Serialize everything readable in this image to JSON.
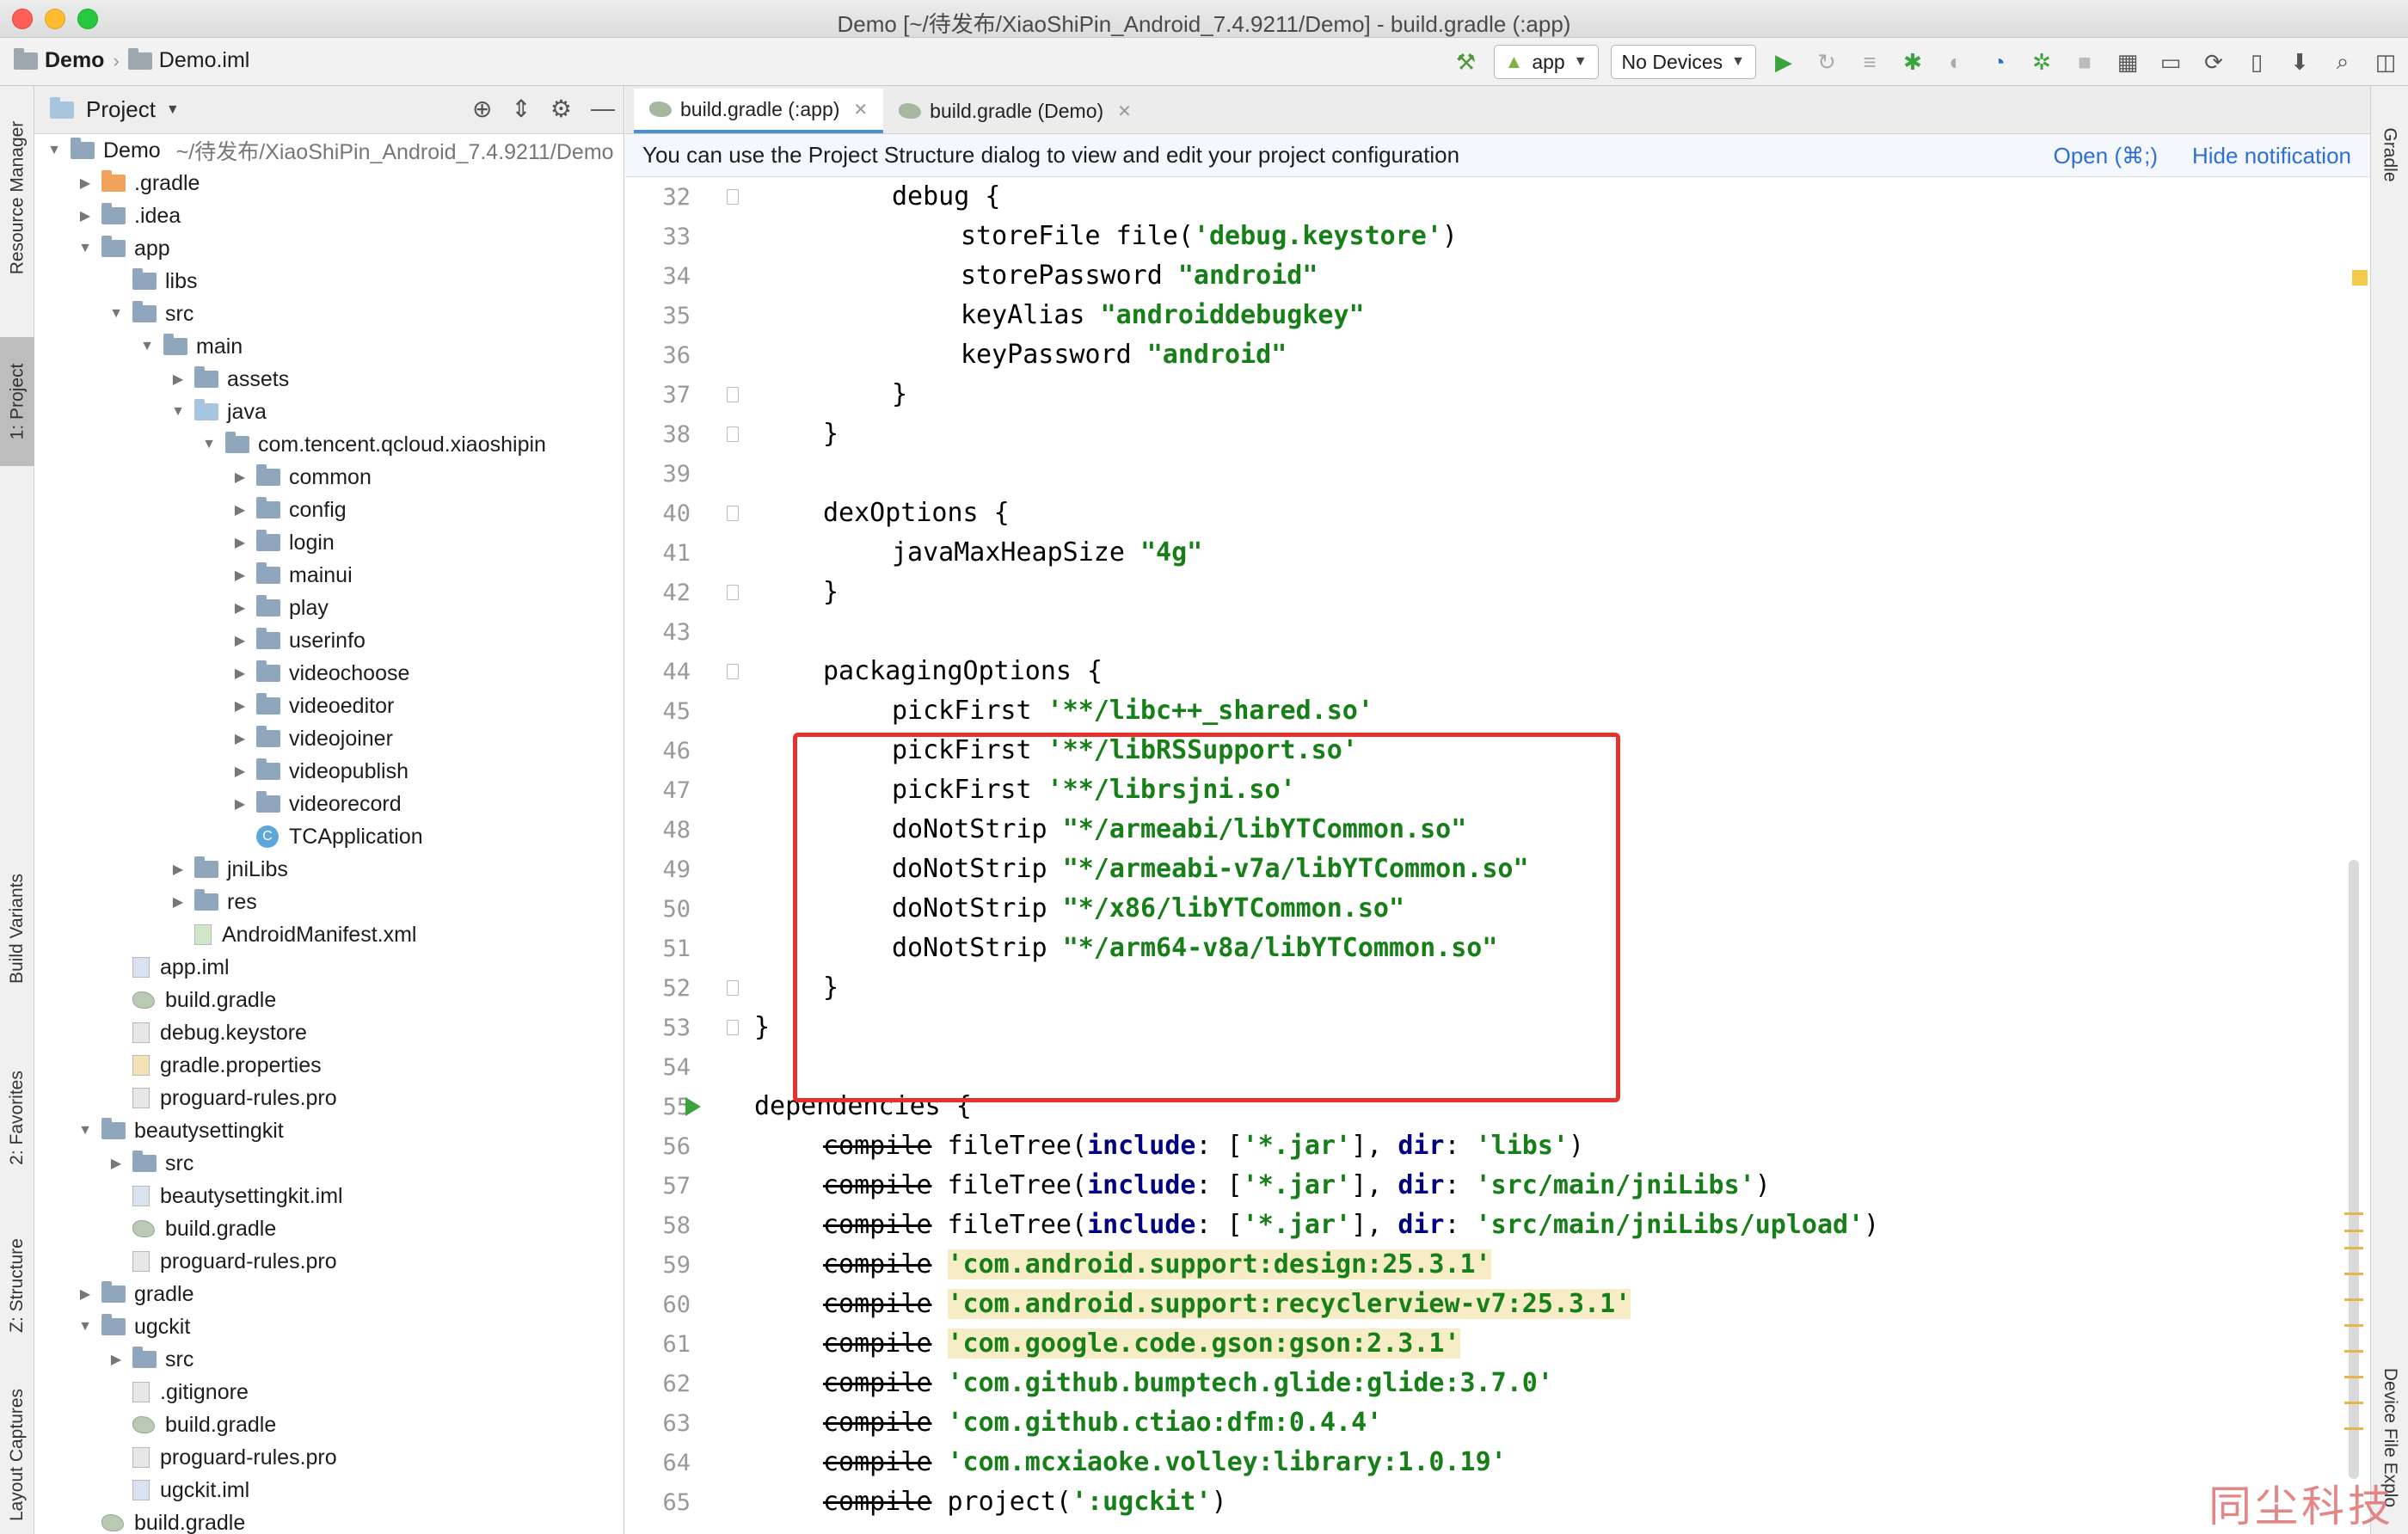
{
  "window": {
    "title": "Demo [~/待发布/XiaoShiPin_Android_7.4.9211/Demo] - build.gradle (:app)"
  },
  "nav": {
    "crumb_project": "Demo",
    "crumb_file": "Demo.iml",
    "run_config": "app",
    "device": "No Devices"
  },
  "left_tools": {
    "resource_manager": "Resource Manager",
    "project": "1: Project",
    "build_variants": "Build Variants",
    "favorites": "2: Favorites",
    "structure": "Z: Structure",
    "layout_captures": "Layout Captures"
  },
  "right_tools": {
    "gradle": "Gradle",
    "device_file": "Device File Explo"
  },
  "project_panel": {
    "title": "Project",
    "tree": [
      {
        "label": "Demo",
        "path": "~/待发布/XiaoShiPin_Android_7.4.9211/Demo",
        "depth": 0,
        "arrow": "down",
        "icon": "folder"
      },
      {
        "label": ".gradle",
        "depth": 1,
        "arrow": "right",
        "icon": "folder-orange"
      },
      {
        "label": ".idea",
        "depth": 1,
        "arrow": "right",
        "icon": "folder"
      },
      {
        "label": "app",
        "depth": 1,
        "arrow": "down",
        "icon": "folder"
      },
      {
        "label": "libs",
        "depth": 2,
        "arrow": "",
        "icon": "folder"
      },
      {
        "label": "src",
        "depth": 2,
        "arrow": "down",
        "icon": "folder"
      },
      {
        "label": "main",
        "depth": 3,
        "arrow": "down",
        "icon": "folder"
      },
      {
        "label": "assets",
        "depth": 4,
        "arrow": "right",
        "icon": "folder"
      },
      {
        "label": "java",
        "depth": 4,
        "arrow": "down",
        "icon": "folder-light"
      },
      {
        "label": "com.tencent.qcloud.xiaoshipin",
        "depth": 5,
        "arrow": "down",
        "icon": "folder"
      },
      {
        "label": "common",
        "depth": 6,
        "arrow": "right",
        "icon": "folder"
      },
      {
        "label": "config",
        "depth": 6,
        "arrow": "right",
        "icon": "folder"
      },
      {
        "label": "login",
        "depth": 6,
        "arrow": "right",
        "icon": "folder"
      },
      {
        "label": "mainui",
        "depth": 6,
        "arrow": "right",
        "icon": "folder"
      },
      {
        "label": "play",
        "depth": 6,
        "arrow": "right",
        "icon": "folder"
      },
      {
        "label": "userinfo",
        "depth": 6,
        "arrow": "right",
        "icon": "folder"
      },
      {
        "label": "videochoose",
        "depth": 6,
        "arrow": "right",
        "icon": "folder"
      },
      {
        "label": "videoeditor",
        "depth": 6,
        "arrow": "right",
        "icon": "folder"
      },
      {
        "label": "videojoiner",
        "depth": 6,
        "arrow": "right",
        "icon": "folder"
      },
      {
        "label": "videopublish",
        "depth": 6,
        "arrow": "right",
        "icon": "folder"
      },
      {
        "label": "videorecord",
        "depth": 6,
        "arrow": "right",
        "icon": "folder"
      },
      {
        "label": "TCApplication",
        "depth": 6,
        "arrow": "",
        "icon": "class"
      },
      {
        "label": "jniLibs",
        "depth": 4,
        "arrow": "right",
        "icon": "folder"
      },
      {
        "label": "res",
        "depth": 4,
        "arrow": "right",
        "icon": "folder"
      },
      {
        "label": "AndroidManifest.xml",
        "depth": 4,
        "arrow": "",
        "icon": "manifest"
      },
      {
        "label": "app.iml",
        "depth": 2,
        "arrow": "",
        "icon": "iml"
      },
      {
        "label": "build.gradle",
        "depth": 2,
        "arrow": "",
        "icon": "gradle"
      },
      {
        "label": "debug.keystore",
        "depth": 2,
        "arrow": "",
        "icon": "file"
      },
      {
        "label": "gradle.properties",
        "depth": 2,
        "arrow": "",
        "icon": "properties"
      },
      {
        "label": "proguard-rules.pro",
        "depth": 2,
        "arrow": "",
        "icon": "file"
      },
      {
        "label": "beautysettingkit",
        "depth": 1,
        "arrow": "down",
        "icon": "folder"
      },
      {
        "label": "src",
        "depth": 2,
        "arrow": "right",
        "icon": "folder"
      },
      {
        "label": "beautysettingkit.iml",
        "depth": 2,
        "arrow": "",
        "icon": "iml"
      },
      {
        "label": "build.gradle",
        "depth": 2,
        "arrow": "",
        "icon": "gradle"
      },
      {
        "label": "proguard-rules.pro",
        "depth": 2,
        "arrow": "",
        "icon": "file"
      },
      {
        "label": "gradle",
        "depth": 1,
        "arrow": "right",
        "icon": "folder"
      },
      {
        "label": "ugckit",
        "depth": 1,
        "arrow": "down",
        "icon": "folder"
      },
      {
        "label": "src",
        "depth": 2,
        "arrow": "right",
        "icon": "folder"
      },
      {
        "label": ".gitignore",
        "depth": 2,
        "arrow": "",
        "icon": "file"
      },
      {
        "label": "build.gradle",
        "depth": 2,
        "arrow": "",
        "icon": "gradle"
      },
      {
        "label": "proguard-rules.pro",
        "depth": 2,
        "arrow": "",
        "icon": "file"
      },
      {
        "label": "ugckit.iml",
        "depth": 2,
        "arrow": "",
        "icon": "iml"
      },
      {
        "label": "build.gradle",
        "depth": 1,
        "arrow": "",
        "icon": "gradle"
      }
    ]
  },
  "editor": {
    "tabs": [
      {
        "label": "build.gradle (:app)",
        "active": true
      },
      {
        "label": "build.gradle (Demo)",
        "active": false
      }
    ],
    "notification": {
      "text": "You can use the Project Structure dialog to view and edit your project configuration",
      "open_link": "Open (⌘;)",
      "hide_link": "Hide notification"
    },
    "lines": [
      {
        "n": "32",
        "indent": 2,
        "parts": [
          [
            "t",
            "debug {"
          ]
        ]
      },
      {
        "n": "33",
        "indent": 3,
        "parts": [
          [
            "t",
            "storeFile file("
          ],
          [
            "s",
            "'debug.keystore'"
          ],
          [
            "t",
            ")"
          ]
        ]
      },
      {
        "n": "34",
        "indent": 3,
        "parts": [
          [
            "t",
            "storePassword "
          ],
          [
            "s",
            "\"android\""
          ]
        ]
      },
      {
        "n": "35",
        "indent": 3,
        "parts": [
          [
            "t",
            "keyAlias "
          ],
          [
            "s",
            "\"androiddebugkey\""
          ]
        ]
      },
      {
        "n": "36",
        "indent": 3,
        "parts": [
          [
            "t",
            "keyPassword "
          ],
          [
            "s",
            "\"android\""
          ]
        ]
      },
      {
        "n": "37",
        "indent": 2,
        "parts": [
          [
            "t",
            "}"
          ]
        ]
      },
      {
        "n": "38",
        "indent": 1,
        "parts": [
          [
            "t",
            "}"
          ]
        ]
      },
      {
        "n": "39",
        "indent": 0,
        "parts": []
      },
      {
        "n": "40",
        "indent": 1,
        "parts": [
          [
            "t",
            "dexOptions {"
          ]
        ]
      },
      {
        "n": "41",
        "indent": 2,
        "parts": [
          [
            "t",
            "javaMaxHeapSize "
          ],
          [
            "s",
            "\"4g\""
          ]
        ]
      },
      {
        "n": "42",
        "indent": 1,
        "parts": [
          [
            "t",
            "}"
          ]
        ]
      },
      {
        "n": "43",
        "indent": 0,
        "parts": []
      },
      {
        "n": "44",
        "indent": 1,
        "parts": [
          [
            "t",
            "packagingOptions {"
          ]
        ]
      },
      {
        "n": "45",
        "indent": 2,
        "parts": [
          [
            "t",
            "pickFirst "
          ],
          [
            "s",
            "'**/libc++_shared.so'"
          ]
        ]
      },
      {
        "n": "46",
        "indent": 2,
        "parts": [
          [
            "t",
            "pickFirst "
          ],
          [
            "s",
            "'**/libRSSupport.so'"
          ]
        ]
      },
      {
        "n": "47",
        "indent": 2,
        "parts": [
          [
            "t",
            "pickFirst "
          ],
          [
            "s",
            "'**/librsjni.so'"
          ]
        ]
      },
      {
        "n": "48",
        "indent": 2,
        "parts": [
          [
            "t",
            "doNotStrip "
          ],
          [
            "s",
            "\"*/armeabi/libYTCommon.so\""
          ]
        ]
      },
      {
        "n": "49",
        "indent": 2,
        "parts": [
          [
            "t",
            "doNotStrip "
          ],
          [
            "s",
            "\"*/armeabi-v7a/libYTCommon.so\""
          ]
        ]
      },
      {
        "n": "50",
        "indent": 2,
        "parts": [
          [
            "t",
            "doNotStrip "
          ],
          [
            "s",
            "\"*/x86/libYTCommon.so\""
          ]
        ]
      },
      {
        "n": "51",
        "indent": 2,
        "parts": [
          [
            "t",
            "doNotStrip "
          ],
          [
            "s",
            "\"*/arm64-v8a/libYTCommon.so\""
          ]
        ]
      },
      {
        "n": "52",
        "indent": 1,
        "parts": [
          [
            "t",
            "}"
          ]
        ]
      },
      {
        "n": "53",
        "indent": 0,
        "parts": [
          [
            "t",
            "}"
          ]
        ]
      },
      {
        "n": "54",
        "indent": 0,
        "parts": []
      },
      {
        "n": "55",
        "indent": 0,
        "parts": [
          [
            "t",
            "dependencies {"
          ]
        ]
      },
      {
        "n": "56",
        "indent": 1,
        "parts": [
          [
            "x",
            "compile"
          ],
          [
            "t",
            " fileTree("
          ],
          [
            "k",
            "include"
          ],
          [
            "t",
            ": ["
          ],
          [
            "s",
            "'*.jar'"
          ],
          [
            "t",
            "], "
          ],
          [
            "k",
            "dir"
          ],
          [
            "t",
            ": "
          ],
          [
            "s",
            "'libs'"
          ],
          [
            "t",
            ")"
          ]
        ]
      },
      {
        "n": "57",
        "indent": 1,
        "parts": [
          [
            "x",
            "compile"
          ],
          [
            "t",
            " fileTree("
          ],
          [
            "k",
            "include"
          ],
          [
            "t",
            ": ["
          ],
          [
            "s",
            "'*.jar'"
          ],
          [
            "t",
            "], "
          ],
          [
            "k",
            "dir"
          ],
          [
            "t",
            ": "
          ],
          [
            "s",
            "'src/main/jniLibs'"
          ],
          [
            "t",
            ")"
          ]
        ]
      },
      {
        "n": "58",
        "indent": 1,
        "parts": [
          [
            "x",
            "compile"
          ],
          [
            "t",
            " fileTree("
          ],
          [
            "k",
            "include"
          ],
          [
            "t",
            ": ["
          ],
          [
            "s",
            "'*.jar'"
          ],
          [
            "t",
            "], "
          ],
          [
            "k",
            "dir"
          ],
          [
            "t",
            ": "
          ],
          [
            "s",
            "'src/main/jniLibs/upload'"
          ],
          [
            "t",
            ")"
          ]
        ]
      },
      {
        "n": "59",
        "indent": 1,
        "parts": [
          [
            "x",
            "compile"
          ],
          [
            "t",
            " "
          ],
          [
            "h",
            "'com.android.support:design:25.3.1'"
          ]
        ]
      },
      {
        "n": "60",
        "indent": 1,
        "parts": [
          [
            "x",
            "compile"
          ],
          [
            "t",
            " "
          ],
          [
            "h",
            "'com.android.support:recyclerview-v7:25.3.1'"
          ]
        ]
      },
      {
        "n": "61",
        "indent": 1,
        "parts": [
          [
            "x",
            "compile"
          ],
          [
            "t",
            " "
          ],
          [
            "h",
            "'com.google.code.gson:gson:2.3.1'"
          ]
        ]
      },
      {
        "n": "62",
        "indent": 1,
        "parts": [
          [
            "x",
            "compile"
          ],
          [
            "t",
            " "
          ],
          [
            "s",
            "'com.github.bumptech.glide:glide:3.7.0'"
          ]
        ]
      },
      {
        "n": "63",
        "indent": 1,
        "parts": [
          [
            "x",
            "compile"
          ],
          [
            "t",
            " "
          ],
          [
            "s",
            "'com.github.ctiao:dfm:0.4.4'"
          ]
        ]
      },
      {
        "n": "64",
        "indent": 1,
        "parts": [
          [
            "x",
            "compile"
          ],
          [
            "t",
            " "
          ],
          [
            "s",
            "'com.mcxiaoke.volley:library:1.0.19'"
          ]
        ]
      },
      {
        "n": "65",
        "indent": 1,
        "parts": [
          [
            "x",
            "compile"
          ],
          [
            "t",
            " project("
          ],
          [
            "s",
            "':ugckit'"
          ],
          [
            "t",
            ")"
          ]
        ]
      }
    ]
  },
  "watermark": "同尘科技",
  "colors": {
    "string": "#167f17",
    "highlight_box": "#e8312d",
    "link": "#2f6fd3"
  }
}
